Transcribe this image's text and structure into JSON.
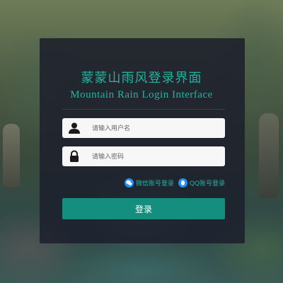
{
  "header": {
    "title_cn": "蒙蒙山雨风登录界面",
    "title_en": "Mountain Rain Login Interface"
  },
  "form": {
    "username": {
      "value": "",
      "placeholder": "请输入用户名",
      "icon": "user-icon"
    },
    "password": {
      "value": "",
      "placeholder": "请输入密码",
      "icon": "lock-icon"
    }
  },
  "alt_login": {
    "wechat_label": "微信账号登录",
    "qq_label": "QQ账号登录"
  },
  "login_button": {
    "label": "登录"
  },
  "colors": {
    "accent": "#1fb4a0",
    "button": "#148f7f",
    "panel": "#1c202c",
    "alt_icon": "#1e90ff"
  }
}
